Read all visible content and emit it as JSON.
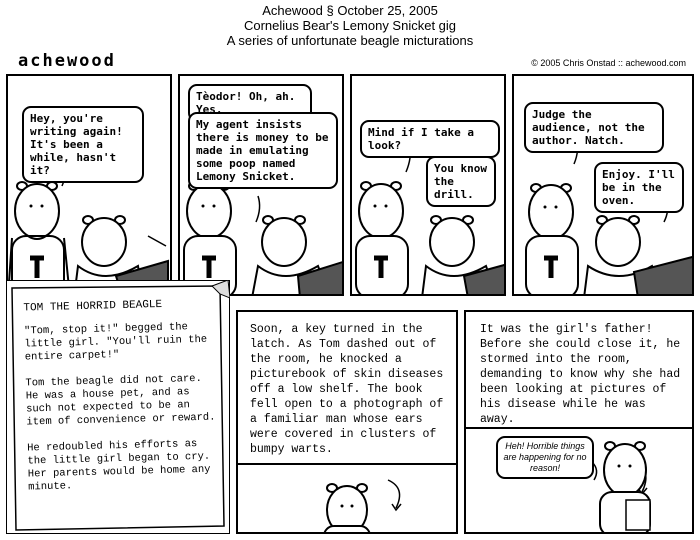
{
  "header": {
    "line1": "Achewood § October 25, 2005",
    "line2": "Cornelius Bear's Lemony Snicket gig",
    "line3": "A series of unfortunate beagle micturations"
  },
  "logo": "achewood",
  "copyright": "© 2005 Chris Onstad :: achewood.com",
  "panels": {
    "p1": {
      "bubble1": "Hey, you're writing again! It's been a while, hasn't it?"
    },
    "p2": {
      "bubble1": "Tèodor! Oh, ah. Yes.",
      "bubble2": "My agent insists there is money to be made in emulating some poop named Lemony Snicket."
    },
    "p3": {
      "bubble1": "Mind if I take a look?",
      "bubble2": "You know the drill."
    },
    "p4": {
      "bubble1": "Judge the audience, not the author. Natch.",
      "bubble2": "Enjoy. I'll be in the oven."
    },
    "p5": {
      "title": "TOM THE HORRID BEAGLE",
      "para1": "\"Tom, stop it!\" begged the little girl. \"You'll ruin the entire carpet!\"",
      "para2": "Tom the beagle did not care. He was a house pet, and as such not expected to be an item of convenience or reward.",
      "para3": "He redoubled his efforts as the little girl began to cry. Her parents would be home any minute."
    },
    "p6": {
      "text": "Soon, a key turned in the latch. As Tom dashed out of the room, he knocked a picturebook of skin diseases off a low shelf. The book fell open to a photograph of a familiar man whose ears were covered in clusters of bumpy warts."
    },
    "p7": {
      "text": "It was the girl's father! Before she could close it, he stormed into the room, demanding to know why she had been looking at pictures of his disease while he was away.",
      "bubble": "Heh! Horrible things are happening for no reason!"
    }
  }
}
